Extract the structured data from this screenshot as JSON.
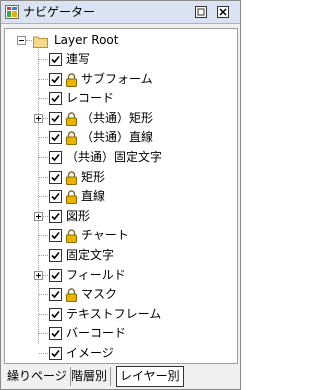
{
  "window": {
    "title": "ナビゲーター"
  },
  "tree": {
    "root_label": "Layer Root",
    "items": [
      {
        "label": "連写",
        "locked": false,
        "expandable": false,
        "checked": true
      },
      {
        "label": "サブフォーム",
        "locked": true,
        "expandable": false,
        "checked": true
      },
      {
        "label": "レコード",
        "locked": false,
        "expandable": false,
        "checked": true
      },
      {
        "label": "（共通）矩形",
        "locked": true,
        "expandable": true,
        "checked": true
      },
      {
        "label": "（共通）直線",
        "locked": true,
        "expandable": false,
        "checked": true
      },
      {
        "label": "（共通）固定文字",
        "locked": false,
        "expandable": false,
        "checked": true
      },
      {
        "label": "矩形",
        "locked": true,
        "expandable": false,
        "checked": true
      },
      {
        "label": "直線",
        "locked": true,
        "expandable": false,
        "checked": true
      },
      {
        "label": "図形",
        "locked": false,
        "expandable": true,
        "checked": true
      },
      {
        "label": "チャート",
        "locked": true,
        "expandable": false,
        "checked": true
      },
      {
        "label": "固定文字",
        "locked": false,
        "expandable": false,
        "checked": true
      },
      {
        "label": "フィールド",
        "locked": false,
        "expandable": true,
        "checked": true
      },
      {
        "label": "マスク",
        "locked": true,
        "expandable": false,
        "checked": true
      },
      {
        "label": "テキストフレーム",
        "locked": false,
        "expandable": false,
        "checked": true
      },
      {
        "label": "バーコード",
        "locked": false,
        "expandable": false,
        "checked": true
      },
      {
        "label": "イメージ",
        "locked": false,
        "expandable": false,
        "checked": true
      }
    ]
  },
  "tabs": [
    {
      "label": "繰りページ",
      "active": false
    },
    {
      "label": "階層別",
      "active": false
    },
    {
      "label": "レイヤー別",
      "active": true
    }
  ],
  "colors": {
    "titlebar": "#d9e3f1",
    "lock_gold": "#e8b400",
    "folder": "#f5d98a"
  }
}
